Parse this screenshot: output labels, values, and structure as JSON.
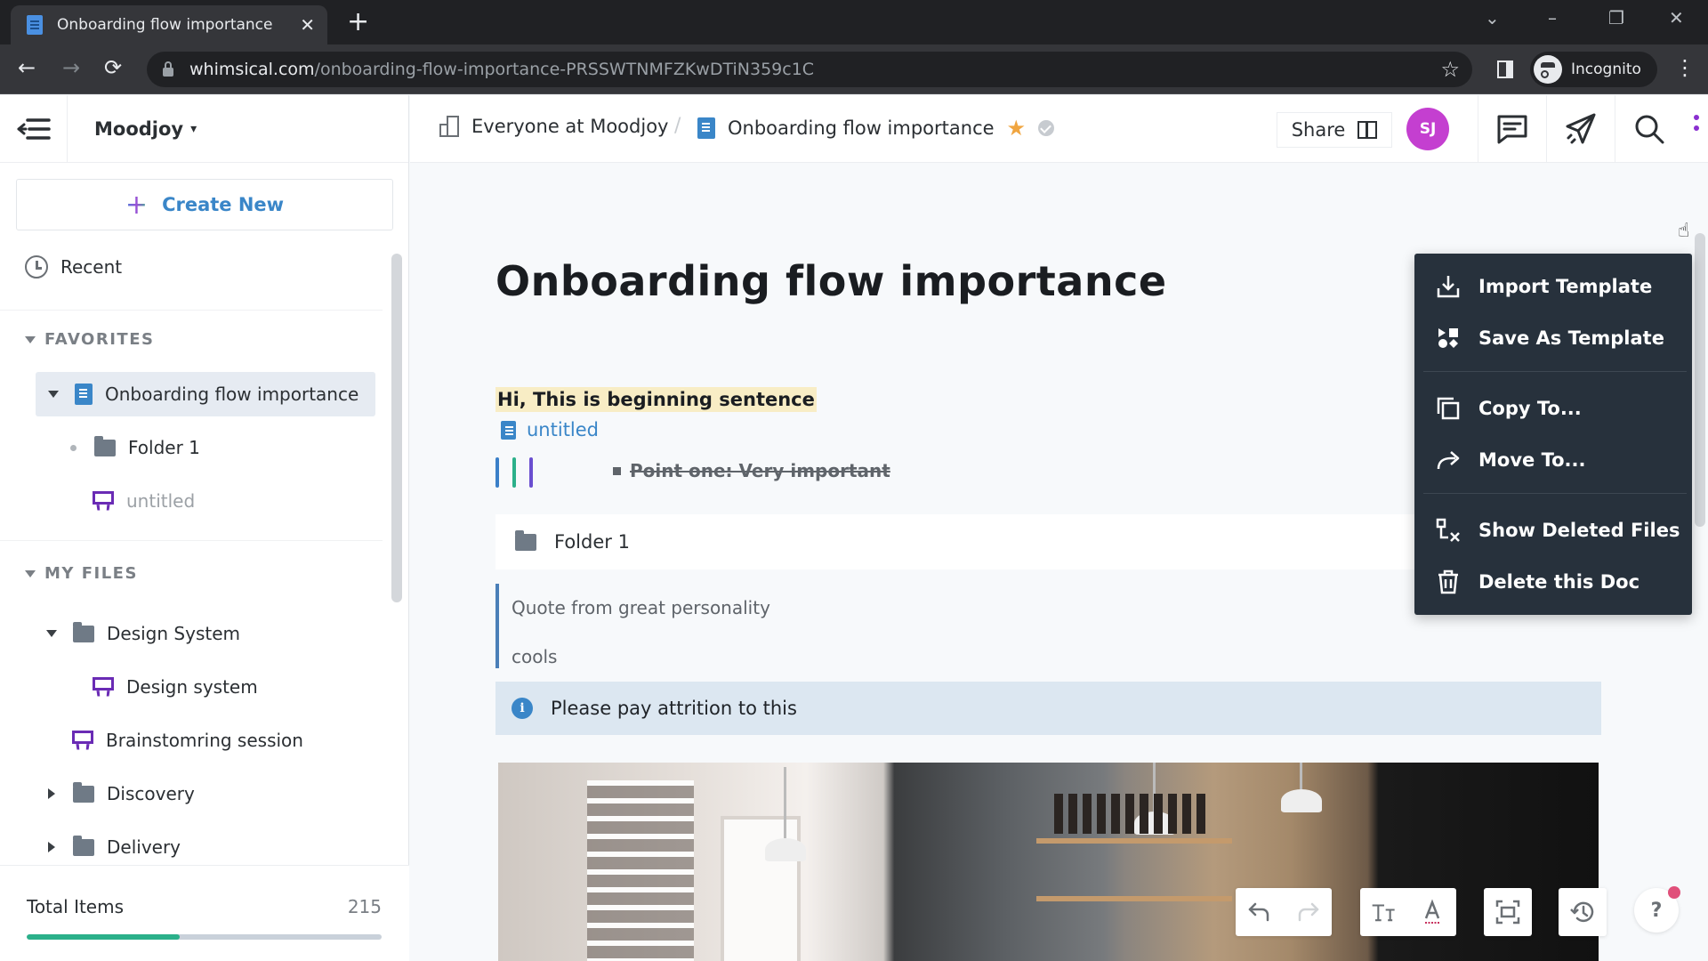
{
  "browser": {
    "tab_title": "Onboarding flow importance",
    "tab_close": "✕",
    "new_tab": "+",
    "url_host": "whimsical.com",
    "url_path": "/onboarding-flow-importance-PRSSWTNMFZKwDTiN359c1C",
    "profile_label": "Incognito",
    "window_controls": {
      "list": "⌄",
      "minimize": "–",
      "restore": "❐",
      "close": "✕"
    },
    "nav": {
      "back": "←",
      "forward": "→",
      "reload": "⟳",
      "bookmark": "☆",
      "menu": "⋮"
    }
  },
  "sidebar": {
    "workspace": "Moodjoy",
    "workspace_chevron": "⌄",
    "create_new": "Create New",
    "create_plus": "+",
    "recent": "Recent",
    "favorites_header": "FAVORITES",
    "favorites": [
      {
        "label": "Onboarding flow importance",
        "type": "doc",
        "expanded": true,
        "active": true
      },
      {
        "label": "Folder 1",
        "type": "folder"
      },
      {
        "label": "untitled",
        "type": "board",
        "muted": true
      }
    ],
    "my_files_header": "MY FILES",
    "my_files": [
      {
        "label": "Design System",
        "type": "folder",
        "expanded": true
      },
      {
        "label": "Design system",
        "type": "board"
      },
      {
        "label": "Brainstomring session",
        "type": "board"
      },
      {
        "label": "Discovery",
        "type": "folder",
        "expanded": false
      },
      {
        "label": "Delivery",
        "type": "folder",
        "expanded": false
      }
    ],
    "total_items_label": "Total Items",
    "total_items_value": "215",
    "total_items_progress_percent": 43
  },
  "header": {
    "breadcrumb_org": "Everyone at Moodjoy",
    "breadcrumb_sep": "/",
    "breadcrumb_doc": "Onboarding flow importance",
    "favorite_star": "★",
    "share_label": "Share",
    "avatar_initials": "SJ"
  },
  "document": {
    "title": "Onboarding flow importance",
    "highlighted_sentence": "Hi, This is beginning sentence",
    "inline_link": "untitled",
    "bullet": "Point one: Very important",
    "folder_card": "Folder 1",
    "quote_lines": [
      "Quote from great personality",
      "cools"
    ],
    "callout": "Please pay attrition to this",
    "callout_icon": "i",
    "bar_colors": [
      "#3a7fc8",
      "#2bb08a",
      "#6a4ed0"
    ]
  },
  "toolbar": {
    "help": "?"
  },
  "menu": {
    "items": [
      {
        "label": "Import Template",
        "icon": "import-icon"
      },
      {
        "label": "Save As Template",
        "icon": "template-shapes-icon"
      },
      {
        "label": "Copy To...",
        "icon": "copy-icon"
      },
      {
        "label": "Move To...",
        "icon": "move-arrow-icon"
      },
      {
        "label": "Show Deleted Files",
        "icon": "deleted-files-icon"
      },
      {
        "label": "Delete this Doc",
        "icon": "trash-icon"
      }
    ]
  },
  "colors": {
    "accent_blue": "#3a86c8",
    "avatar": "#c43fd0",
    "progress": "#2bb08a",
    "menu_bg": "#27313c",
    "board_purple": "#6a2bb5",
    "highlight": "#f8edc5"
  }
}
